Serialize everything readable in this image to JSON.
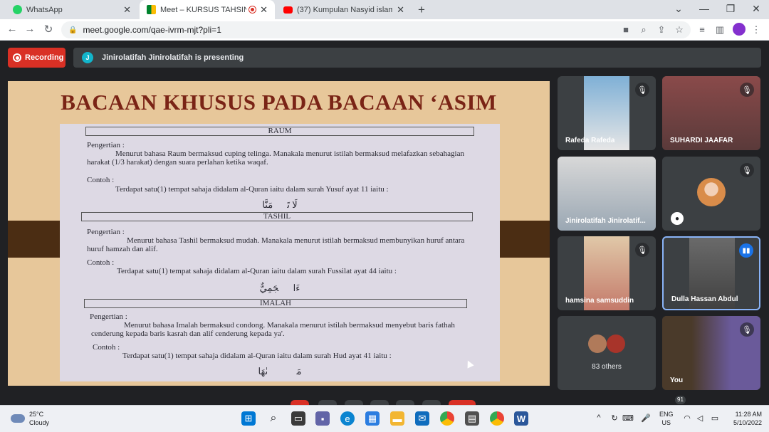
{
  "browser": {
    "tabs": [
      {
        "title": "WhatsApp",
        "icon": "whatsapp-icon",
        "active": false
      },
      {
        "title": "Meet – KURSUS TAHSIN AL-Q",
        "icon": "google-meet-icon",
        "active": true
      },
      {
        "title": "(37) Kumpulan Nasyid islami tern",
        "icon": "youtube-icon",
        "active": false
      }
    ],
    "close_glyph": "✕",
    "new_tab_glyph": "+",
    "url": "meet.google.com/qae-ivrm-mjt?pli=1",
    "window_controls": [
      "⌄",
      "—",
      "❐",
      "✕"
    ]
  },
  "meet": {
    "recording_label": "Recording",
    "presenter_initial": "J",
    "presenting_text": "Jinirolatifah Jinirolatifah is presenting"
  },
  "slide": {
    "title": "BACAAN KHUSUS PADA BACAAN ‘ASIM",
    "sections": [
      {
        "heading": "RAUM",
        "definition_label": "Pengertian :",
        "definition": "Menurut bahasa Raum bermaksud cuping telinga. Manakala menurut istilah bermaksud melafazkan sebahagian harakat (1/3 harakat) dengan suara perlahan ketika waqaf.",
        "example_label": "Contoh :",
        "example": "Terdapat satu(1) tempat sahaja didalam al-Quran iaitu dalam surah Yusuf ayat 11 iaitu :",
        "arabic": "لَا تَأۡمَنَّا"
      },
      {
        "heading": "TASHIL",
        "definition_label": "Pengertian :",
        "definition": "Menurut bahasa Tashil bermaksud mudah. Manakala menurut istilah bermaksud membunyikan huruf antara huruf hamzah dan alif.",
        "example_label": "Contoh :",
        "example": "Terdapat satu(1) tempat sahaja didalam al-Quran iaitu dalam surah Fussilat ayat 44 iaitu :",
        "arabic": "ءَاعۡجَمِيٌّ"
      },
      {
        "heading": "IMALAH",
        "definition_label": "Pengertian :",
        "definition": "Menurut bahasa Imalah bermaksud condong. Manakala menurut istilah bermaksud menyebut baris fathah cenderung kepada baris kasrah dan alif cenderung kepada ya'.",
        "example_label": "Contoh :",
        "example": "Terdapat satu(1) tempat sahaja didalam al-Quran iaitu dalam surah Hud ayat 41 iaitu :",
        "arabic": "مَجۡرٜىٰهَا"
      }
    ]
  },
  "participants": [
    {
      "name": "Rafeda Rafeda",
      "muted": true
    },
    {
      "name": "SUHARDI JAAFAR",
      "muted": true
    },
    {
      "name": "Jinirolatifah Jinirolatif...",
      "muted": false
    },
    {
      "name": "",
      "muted": true
    },
    {
      "name": "hamsina samsuddin",
      "muted": true
    },
    {
      "name": "Dulla Hassan Abdul",
      "muted": false,
      "speaking": true
    },
    {
      "name": "83 others",
      "muted": false
    },
    {
      "name": "You",
      "muted": true
    }
  ],
  "participant_count_badge": "91",
  "taskbar": {
    "weather_temp": "25°C",
    "weather_desc": "Cloudy",
    "lang_1": "ENG",
    "lang_2": "US",
    "time": "11:28 AM",
    "date": "5/10/2022"
  },
  "colors": {
    "recording": "#d93025",
    "meet_bg": "#202124",
    "tile_bg": "#3c4043",
    "slide_title": "#7a2416",
    "speaking_border": "#8ab4f8"
  }
}
